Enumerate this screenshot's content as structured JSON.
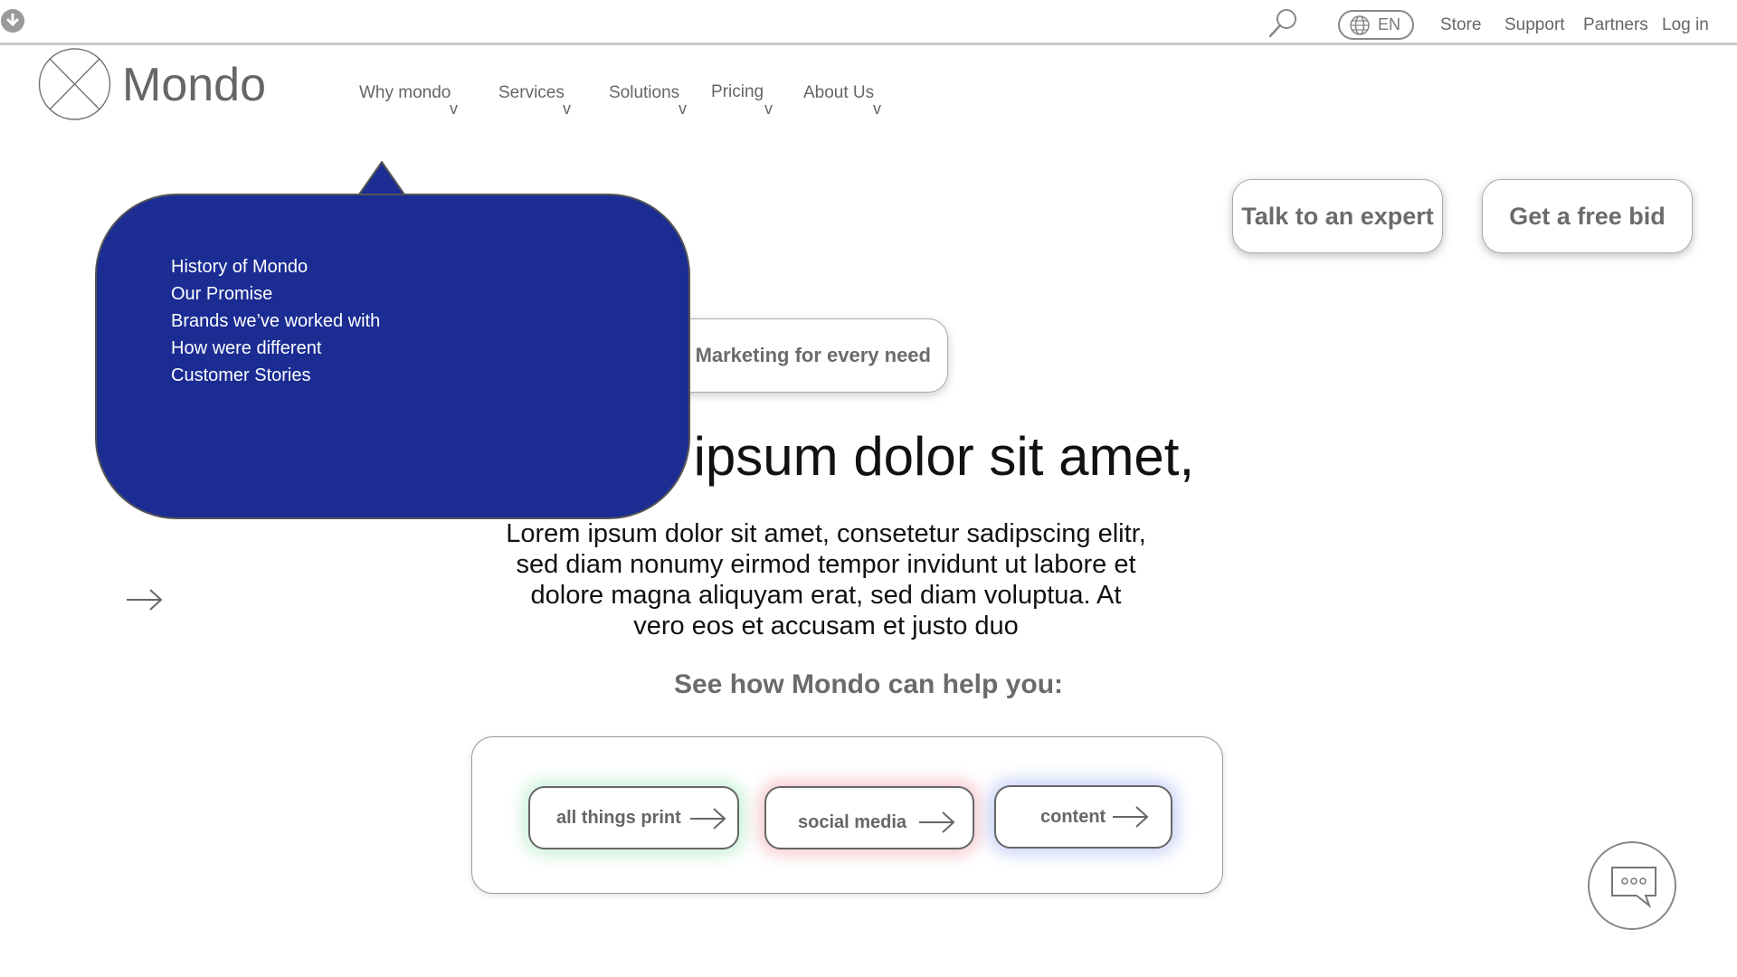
{
  "topbar": {
    "language": "EN",
    "links": {
      "store": "Store",
      "support": "Support",
      "partners": "Partners",
      "login": "Log in"
    }
  },
  "brand": {
    "name": "Mondo"
  },
  "nav": {
    "why": "Why mondo",
    "services": "Services",
    "solutions": "Solutions",
    "pricing": "Pricing",
    "about": "About Us",
    "chevron": "v"
  },
  "cta": {
    "expert": "Talk to an expert",
    "bid": "Get a free bid"
  },
  "dropdown": {
    "items": [
      "History of Mondo",
      "Our Promise",
      "Brands we’ve worked with",
      "How were different",
      "Customer Stories"
    ]
  },
  "hero": {
    "tagline": "Marketing for every need",
    "title": "Lorem ipsum dolor sit amet,",
    "body": "Lorem ipsum dolor sit amet, consetetur sadipscing elitr, sed diam nonumy eirmod tempor invidunt ut labore et dolore magna aliquyam erat, sed diam voluptua. At vero eos et accusam et justo duo",
    "helper": "See how Mondo can help you:"
  },
  "options": {
    "print": "all things print",
    "social": "social media",
    "content": "content"
  },
  "colors": {
    "dropdown_bg": "#1b2c93",
    "print_glow": "#c9f0d8",
    "social_glow": "#f6c9cf",
    "content_glow": "#c9d2f6"
  }
}
